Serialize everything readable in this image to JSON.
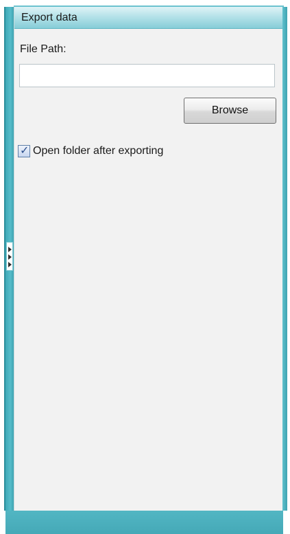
{
  "panel": {
    "title": "Export data"
  },
  "file_path": {
    "label": "File Path:",
    "value": "",
    "placeholder": ""
  },
  "browse_button": {
    "label": "Browse"
  },
  "open_folder_checkbox": {
    "label": "Open folder after exporting",
    "checked": true,
    "check_glyph": "✓"
  },
  "colors": {
    "accent": "#4fb3c1",
    "header_gradient_top": "#dff3f6",
    "header_gradient_bottom": "#86cdd8",
    "panel_background": "#f2f2f2"
  },
  "icons": {
    "splitter_grip": "collapse-arrows-icon",
    "checkbox_mark": "checkmark-icon"
  }
}
